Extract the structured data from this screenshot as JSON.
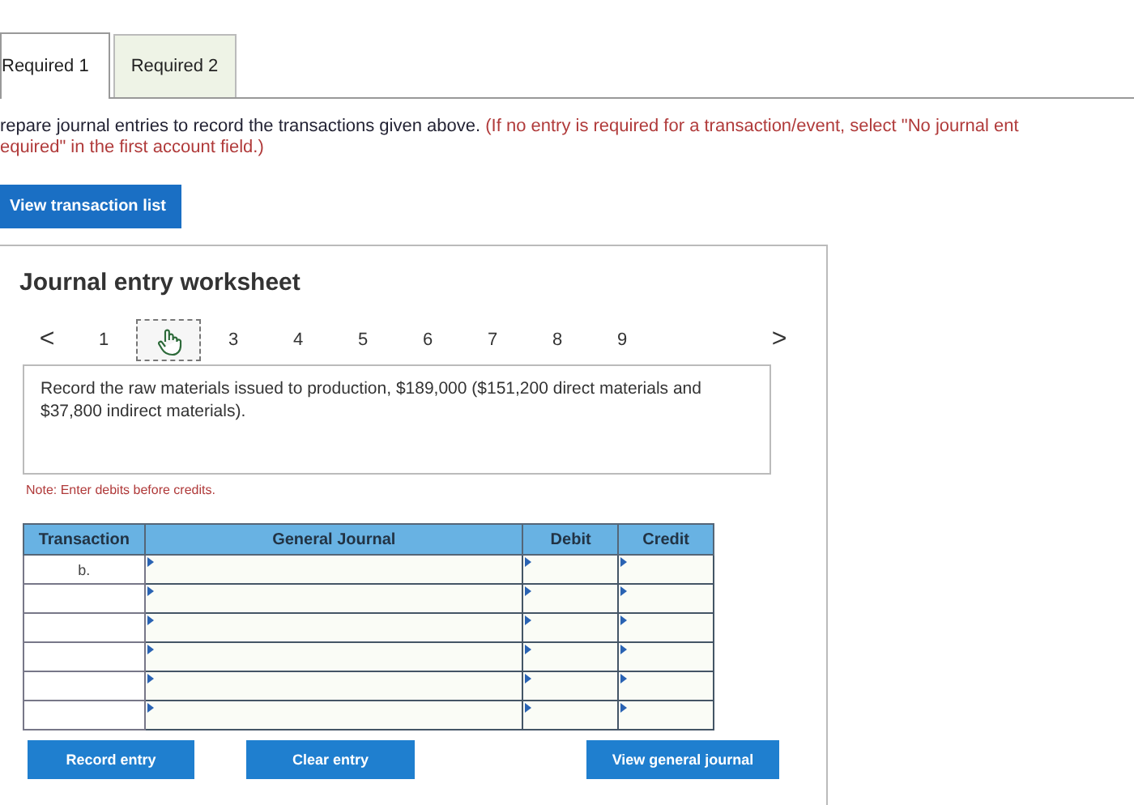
{
  "tabs": [
    {
      "label": "Required 1",
      "selected": true
    },
    {
      "label": "Required 2",
      "selected": false
    }
  ],
  "instruction": {
    "main": "repare journal entries to record the transactions given above.",
    "hint_lines": [
      "(If no entry is required for a transaction/event, select \"No journal ent",
      "equired\" in the first account field.)"
    ]
  },
  "view_transaction_button": "View transaction list",
  "worksheet": {
    "title": "Journal entry worksheet",
    "pager": {
      "prev": "<",
      "next": ">",
      "pages": [
        {
          "label": "1",
          "selected": false
        },
        {
          "selected": true
        },
        {
          "label": "3",
          "selected": false
        },
        {
          "label": "4",
          "selected": false
        },
        {
          "label": "5",
          "selected": false
        },
        {
          "label": "6",
          "selected": false
        },
        {
          "label": "7",
          "selected": false
        },
        {
          "label": "8",
          "selected": false
        },
        {
          "label": "9",
          "selected": false
        }
      ]
    },
    "description": "Record the raw materials issued to production, $189,000 ($151,200 direct materials and $37,800 indirect materials).",
    "note": "Note: Enter debits before credits.",
    "table": {
      "columns": [
        "Transaction",
        "General Journal",
        "Debit",
        "Credit"
      ],
      "rows": [
        {
          "transaction": "b."
        },
        {},
        {},
        {},
        {},
        {}
      ]
    },
    "buttons": [
      "Record entry",
      "Clear entry",
      "View general journal"
    ]
  }
}
